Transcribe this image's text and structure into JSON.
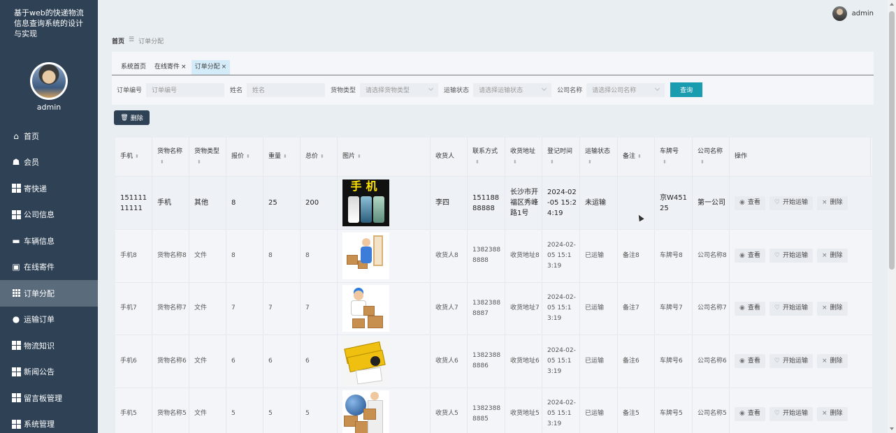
{
  "app": {
    "title": "基于web的快递物流信息查询系统的设计与实现",
    "user": "admin"
  },
  "sidebar": {
    "admin_name": "admin",
    "items": [
      {
        "label": "首页",
        "icon": "home-icon"
      },
      {
        "label": "会员",
        "icon": "member-icon"
      },
      {
        "label": "寄快递",
        "icon": "grid-icon"
      },
      {
        "label": "公司信息",
        "icon": "grid-icon"
      },
      {
        "label": "车辆信息",
        "icon": "chat-icon"
      },
      {
        "label": "在线寄件",
        "icon": "clipboard-icon"
      },
      {
        "label": "订单分配",
        "icon": "grid9-icon",
        "active": true
      },
      {
        "label": "运输订单",
        "icon": "pin-icon"
      },
      {
        "label": "物流知识",
        "icon": "grid-icon"
      },
      {
        "label": "新闻公告",
        "icon": "grid-icon"
      },
      {
        "label": "留言板管理",
        "icon": "grid-icon"
      },
      {
        "label": "系统管理",
        "icon": "grid-icon"
      }
    ]
  },
  "breadcrumb": {
    "home": "首页",
    "sep": "☰",
    "current": "订单分配"
  },
  "tabs": [
    {
      "label": "系统首页",
      "closable": false,
      "active": false
    },
    {
      "label": "在线寄件",
      "closable": true,
      "active": false
    },
    {
      "label": "订单分配",
      "closable": true,
      "active": true
    }
  ],
  "filters": {
    "order_no_label": "订单编号",
    "order_no_placeholder": "订单编号",
    "name_label": "姓名",
    "name_placeholder": "姓名",
    "cargo_type_label": "货物类型",
    "cargo_type_placeholder": "请选择货物类型",
    "transport_status_label": "运输状态",
    "transport_status_placeholder": "请选择运输状态",
    "company_label": "公司名称",
    "company_placeholder": "请选择公司名称",
    "query_button": "查询"
  },
  "toolbar": {
    "delete_label": "删除"
  },
  "table": {
    "headers": [
      "手机",
      "货物名称",
      "货物类型",
      "报价",
      "重量",
      "总价",
      "图片",
      "收货人",
      "联系方式",
      "收货地址",
      "登记时间",
      "运输状态",
      "备注",
      "车牌号",
      "公司名称",
      "操作"
    ],
    "actions": {
      "view": "查看",
      "start": "开始运输",
      "delete": "删除"
    },
    "rows": [
      {
        "phone": "15111111111",
        "name": "手机",
        "type": "其他",
        "quote": "8",
        "weight": "25",
        "total": "200",
        "image": "phone",
        "receiver": "李四",
        "contact": "15118888888",
        "address": "长沙市开福区秀峰路1号",
        "time": "2024-02-05 15:24:19",
        "status": "未运输",
        "note": "",
        "plate": "京W45125",
        "company": "第一公司",
        "image_text": "手机"
      },
      {
        "phone": "手机8",
        "name": "货物名称8",
        "type": "文件",
        "quote": "8",
        "weight": "8",
        "total": "8",
        "image": "courier1",
        "receiver": "收货人8",
        "contact": "13823888888",
        "address": "收货地址8",
        "time": "2024-02-05 15:13:19",
        "status": "已运输",
        "note": "备注8",
        "plate": "车牌号8",
        "company": "公司名称8"
      },
      {
        "phone": "手机7",
        "name": "货物名称7",
        "type": "文件",
        "quote": "7",
        "weight": "7",
        "total": "7",
        "image": "courier2",
        "receiver": "收货人7",
        "contact": "13823888887",
        "address": "收货地址7",
        "time": "2024-02-05 15:13:19",
        "status": "已运输",
        "note": "备注7",
        "plate": "车牌号7",
        "company": "公司名称7"
      },
      {
        "phone": "手机6",
        "name": "货物名称6",
        "type": "文件",
        "quote": "6",
        "weight": "6",
        "total": "6",
        "image": "cards",
        "receiver": "收货人6",
        "contact": "13823888886",
        "address": "收货地址6",
        "time": "2024-02-05 15:13:19",
        "status": "已运输",
        "note": "备注6",
        "plate": "车牌号6",
        "company": "公司名称6"
      },
      {
        "phone": "手机5",
        "name": "货物名称5",
        "type": "文件",
        "quote": "5",
        "weight": "5",
        "total": "5",
        "image": "globe",
        "receiver": "收货人5",
        "contact": "13823888885",
        "address": "收货地址5",
        "time": "2024-02-05 15:13:19",
        "status": "已运输",
        "note": "备注5",
        "plate": "车牌号5",
        "company": "公司名称5"
      }
    ]
  }
}
